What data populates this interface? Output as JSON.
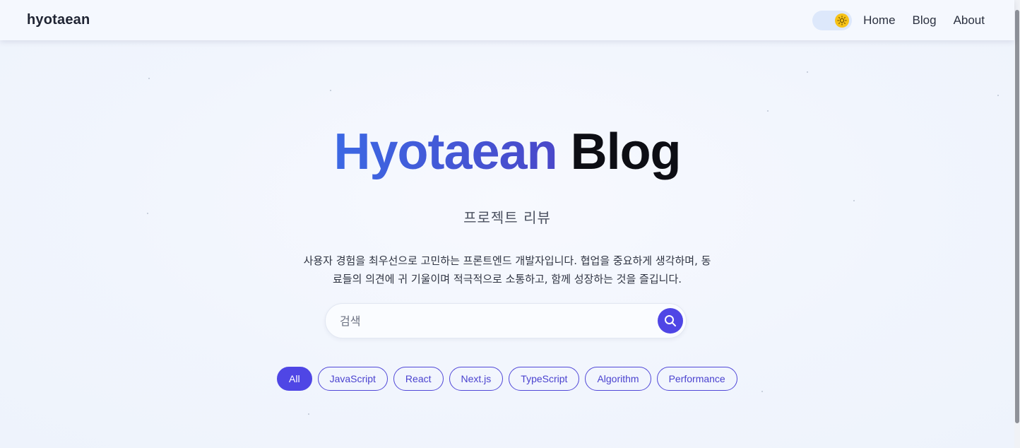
{
  "navbar": {
    "brand": "hyotaean",
    "links": [
      "Home",
      "Blog",
      "About"
    ]
  },
  "hero": {
    "title_accent": "Hyotaean",
    "title_rest": "Blog",
    "subtitle": "프로젝트 리뷰",
    "description_line1": "사용자 경험을 최우선으로 고민하는 프론트엔드 개발자입니다. 협업을 중요하게 생각하며, 동",
    "description_line2": "료들의 의견에 귀 기울이며 적극적으로 소통하고, 함께 성장하는 것을 즐깁니다."
  },
  "search": {
    "placeholder": "검색",
    "value": ""
  },
  "tags": [
    "All",
    "JavaScript",
    "React",
    "Next.js",
    "TypeScript",
    "Algorithm",
    "Performance"
  ],
  "active_tag": "All",
  "icons": {
    "theme": "sun-icon",
    "search": "search-icon"
  },
  "colors": {
    "accent": "#4f46e5",
    "title_gradient_start": "#3c68e4",
    "title_gradient_end": "#4a48c9",
    "sun": "#f6c218"
  }
}
